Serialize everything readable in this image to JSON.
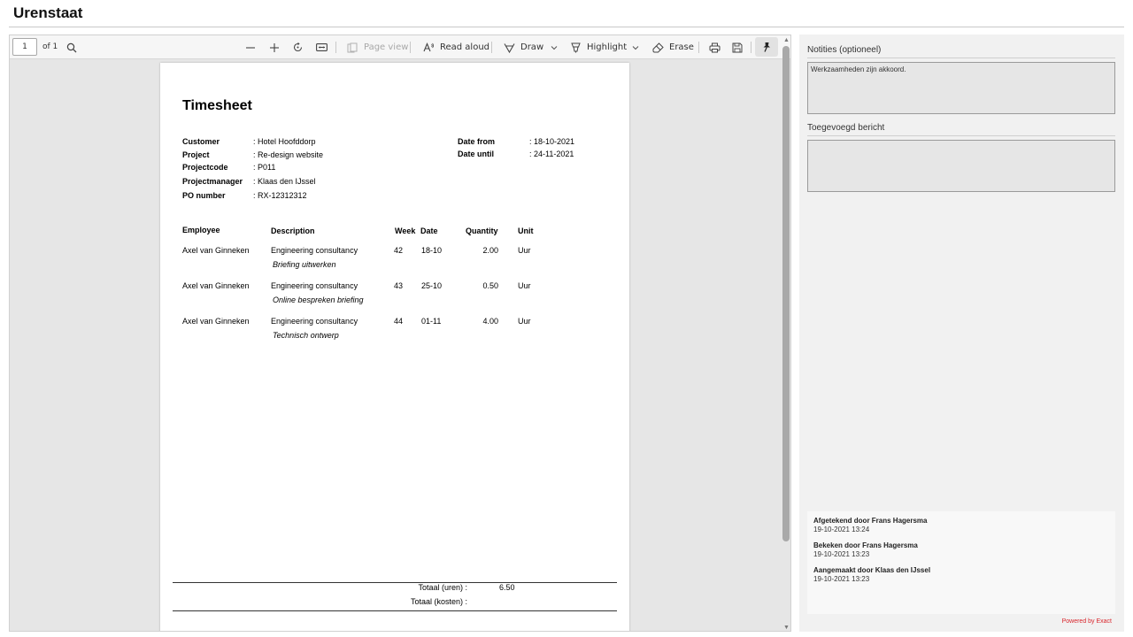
{
  "page": {
    "title": "Urenstaat"
  },
  "toolbar": {
    "page_number": "1",
    "page_of": "of 1",
    "page_view": "Page view",
    "read_aloud": "Read aloud",
    "draw": "Draw",
    "highlight": "Highlight",
    "erase": "Erase"
  },
  "document": {
    "title": "Timesheet",
    "meta_left": [
      {
        "label": "Customer",
        "value": ": Hotel Hoofddorp"
      },
      {
        "label": "Project",
        "value": ": Re-design website"
      },
      {
        "label": "Projectcode",
        "value": ": P011"
      },
      {
        "label": "Projectmanager",
        "value": ": Klaas den IJssel"
      },
      {
        "label": "PO number",
        "value": ": RX-12312312"
      }
    ],
    "meta_right": [
      {
        "label": "Date from",
        "value": ": 18-10-2021"
      },
      {
        "label": "Date until",
        "value": ": 24-11-2021"
      }
    ],
    "columns": {
      "employee": "Employee",
      "description": "Description",
      "week": "Week",
      "date": "Date",
      "quantity": "Quantity",
      "unit": "Unit"
    },
    "rows": [
      {
        "employee": "Axel van Ginneken",
        "description": "Engineering consultancy",
        "note": "Briefing uitwerken",
        "week": "42",
        "date": "18-10",
        "quantity": "2.00",
        "unit": "Uur"
      },
      {
        "employee": "Axel van Ginneken",
        "description": "Engineering consultancy",
        "note": "Online bespreken briefing",
        "week": "43",
        "date": "25-10",
        "quantity": "0.50",
        "unit": "Uur"
      },
      {
        "employee": "Axel van Ginneken",
        "description": "Engineering consultancy",
        "note": "Technisch ontwerp",
        "week": "44",
        "date": "01-11",
        "quantity": "4.00",
        "unit": "Uur"
      }
    ],
    "totals": {
      "hours_label": "Totaal (uren) :",
      "hours_value": "6.50",
      "cost_label": "Totaal (kosten) :"
    }
  },
  "side": {
    "notes_label": "Notities (optioneel)",
    "notes_value": "Werkzaamheden zijn akkoord.",
    "message_label": "Toegevoegd bericht",
    "message_value": "",
    "history": [
      {
        "title": "Afgetekend door Frans Hagersma",
        "date": "19-10-2021 13:24"
      },
      {
        "title": "Bekeken door Frans Hagersma",
        "date": "19-10-2021 13:23"
      },
      {
        "title": "Aangemaakt door Klaas den IJssel",
        "date": "19-10-2021 13:23"
      }
    ],
    "powered_by": "Powered by Exact"
  },
  "colors": {
    "powered_red": "#d9262d",
    "scroll_thumb": "#a9a9a9"
  }
}
